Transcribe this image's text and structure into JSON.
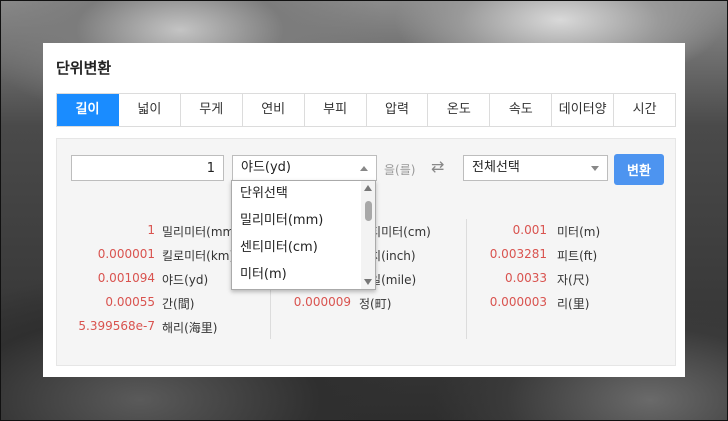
{
  "title": "단위변환",
  "tabs": [
    {
      "label": "길이",
      "active": true
    },
    {
      "label": "넓이"
    },
    {
      "label": "무게"
    },
    {
      "label": "연비"
    },
    {
      "label": "부피"
    },
    {
      "label": "압력"
    },
    {
      "label": "온도"
    },
    {
      "label": "속도"
    },
    {
      "label": "데이터양"
    },
    {
      "label": "시간"
    }
  ],
  "converter": {
    "input_value": "1",
    "from_unit": "야드(yd)",
    "josa": "을(를)",
    "swap_icon": "⇄",
    "to_unit": "전체선택",
    "convert_label": "변환"
  },
  "dropdown": {
    "options": [
      "단위선택",
      "밀리미터(mm)",
      "센티미터(cm)",
      "미터(m)"
    ]
  },
  "results": {
    "col1": [
      {
        "value": "1",
        "unit": "밀리미터(mm)"
      },
      {
        "value": "0.000001",
        "unit": "킬로미터(km)"
      },
      {
        "value": "0.001094",
        "unit": "야드(yd)"
      },
      {
        "value": "0.00055",
        "unit": "간(間)"
      },
      {
        "value": "5.399568e-7",
        "unit": "해리(海里)"
      }
    ],
    "col2": [
      {
        "value": "",
        "unit": "센티미터(cm)"
      },
      {
        "value": "",
        "unit": "인치(inch)"
      },
      {
        "value": "",
        "unit": "마일(mile)"
      },
      {
        "value": "0.000009",
        "unit": "정(町)"
      }
    ],
    "col3": [
      {
        "value": "0.001",
        "unit": "미터(m)"
      },
      {
        "value": "0.003281",
        "unit": "피트(ft)"
      },
      {
        "value": "0.0033",
        "unit": "자(尺)"
      },
      {
        "value": "0.000003",
        "unit": "리(里)"
      }
    ]
  },
  "colors": {
    "accent": "#1a8cff",
    "button": "#4d94f0",
    "value_red": "#d9534f"
  }
}
